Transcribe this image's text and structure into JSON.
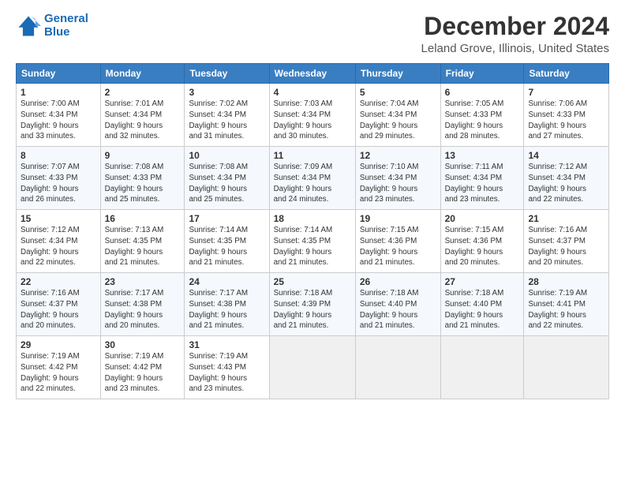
{
  "logo": {
    "line1": "General",
    "line2": "Blue"
  },
  "title": "December 2024",
  "subtitle": "Leland Grove, Illinois, United States",
  "headers": [
    "Sunday",
    "Monday",
    "Tuesday",
    "Wednesday",
    "Thursday",
    "Friday",
    "Saturday"
  ],
  "weeks": [
    [
      {
        "day": "1",
        "info": "Sunrise: 7:00 AM\nSunset: 4:34 PM\nDaylight: 9 hours\nand 33 minutes."
      },
      {
        "day": "2",
        "info": "Sunrise: 7:01 AM\nSunset: 4:34 PM\nDaylight: 9 hours\nand 32 minutes."
      },
      {
        "day": "3",
        "info": "Sunrise: 7:02 AM\nSunset: 4:34 PM\nDaylight: 9 hours\nand 31 minutes."
      },
      {
        "day": "4",
        "info": "Sunrise: 7:03 AM\nSunset: 4:34 PM\nDaylight: 9 hours\nand 30 minutes."
      },
      {
        "day": "5",
        "info": "Sunrise: 7:04 AM\nSunset: 4:34 PM\nDaylight: 9 hours\nand 29 minutes."
      },
      {
        "day": "6",
        "info": "Sunrise: 7:05 AM\nSunset: 4:33 PM\nDaylight: 9 hours\nand 28 minutes."
      },
      {
        "day": "7",
        "info": "Sunrise: 7:06 AM\nSunset: 4:33 PM\nDaylight: 9 hours\nand 27 minutes."
      }
    ],
    [
      {
        "day": "8",
        "info": "Sunrise: 7:07 AM\nSunset: 4:33 PM\nDaylight: 9 hours\nand 26 minutes."
      },
      {
        "day": "9",
        "info": "Sunrise: 7:08 AM\nSunset: 4:33 PM\nDaylight: 9 hours\nand 25 minutes."
      },
      {
        "day": "10",
        "info": "Sunrise: 7:08 AM\nSunset: 4:34 PM\nDaylight: 9 hours\nand 25 minutes."
      },
      {
        "day": "11",
        "info": "Sunrise: 7:09 AM\nSunset: 4:34 PM\nDaylight: 9 hours\nand 24 minutes."
      },
      {
        "day": "12",
        "info": "Sunrise: 7:10 AM\nSunset: 4:34 PM\nDaylight: 9 hours\nand 23 minutes."
      },
      {
        "day": "13",
        "info": "Sunrise: 7:11 AM\nSunset: 4:34 PM\nDaylight: 9 hours\nand 23 minutes."
      },
      {
        "day": "14",
        "info": "Sunrise: 7:12 AM\nSunset: 4:34 PM\nDaylight: 9 hours\nand 22 minutes."
      }
    ],
    [
      {
        "day": "15",
        "info": "Sunrise: 7:12 AM\nSunset: 4:34 PM\nDaylight: 9 hours\nand 22 minutes."
      },
      {
        "day": "16",
        "info": "Sunrise: 7:13 AM\nSunset: 4:35 PM\nDaylight: 9 hours\nand 21 minutes."
      },
      {
        "day": "17",
        "info": "Sunrise: 7:14 AM\nSunset: 4:35 PM\nDaylight: 9 hours\nand 21 minutes."
      },
      {
        "day": "18",
        "info": "Sunrise: 7:14 AM\nSunset: 4:35 PM\nDaylight: 9 hours\nand 21 minutes."
      },
      {
        "day": "19",
        "info": "Sunrise: 7:15 AM\nSunset: 4:36 PM\nDaylight: 9 hours\nand 21 minutes."
      },
      {
        "day": "20",
        "info": "Sunrise: 7:15 AM\nSunset: 4:36 PM\nDaylight: 9 hours\nand 20 minutes."
      },
      {
        "day": "21",
        "info": "Sunrise: 7:16 AM\nSunset: 4:37 PM\nDaylight: 9 hours\nand 20 minutes."
      }
    ],
    [
      {
        "day": "22",
        "info": "Sunrise: 7:16 AM\nSunset: 4:37 PM\nDaylight: 9 hours\nand 20 minutes."
      },
      {
        "day": "23",
        "info": "Sunrise: 7:17 AM\nSunset: 4:38 PM\nDaylight: 9 hours\nand 20 minutes."
      },
      {
        "day": "24",
        "info": "Sunrise: 7:17 AM\nSunset: 4:38 PM\nDaylight: 9 hours\nand 21 minutes."
      },
      {
        "day": "25",
        "info": "Sunrise: 7:18 AM\nSunset: 4:39 PM\nDaylight: 9 hours\nand 21 minutes."
      },
      {
        "day": "26",
        "info": "Sunrise: 7:18 AM\nSunset: 4:40 PM\nDaylight: 9 hours\nand 21 minutes."
      },
      {
        "day": "27",
        "info": "Sunrise: 7:18 AM\nSunset: 4:40 PM\nDaylight: 9 hours\nand 21 minutes."
      },
      {
        "day": "28",
        "info": "Sunrise: 7:19 AM\nSunset: 4:41 PM\nDaylight: 9 hours\nand 22 minutes."
      }
    ],
    [
      {
        "day": "29",
        "info": "Sunrise: 7:19 AM\nSunset: 4:42 PM\nDaylight: 9 hours\nand 22 minutes."
      },
      {
        "day": "30",
        "info": "Sunrise: 7:19 AM\nSunset: 4:42 PM\nDaylight: 9 hours\nand 23 minutes."
      },
      {
        "day": "31",
        "info": "Sunrise: 7:19 AM\nSunset: 4:43 PM\nDaylight: 9 hours\nand 23 minutes."
      },
      null,
      null,
      null,
      null
    ]
  ]
}
